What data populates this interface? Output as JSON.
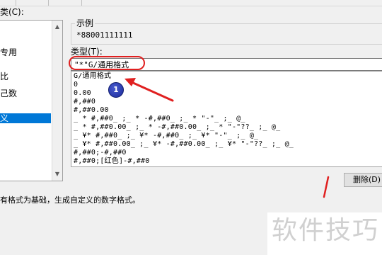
{
  "dialog": {
    "category_label": "类(C):",
    "category_items": [
      "专用",
      "比",
      "己数",
      "义"
    ],
    "sample_title": "示例",
    "sample_value": "*88001111111",
    "type_label": "类型(T):",
    "type_input_value": "\"*\"G/通用格式",
    "format_list": [
      "G/通用格式",
      "0",
      "0.00",
      "#,##0",
      "#,##0.00",
      "_ * #,##0_ ;_ * -#,##0_ ;_ * \"-\"_ ;_ @_",
      "_ * #,##0.00_ ;_ * -#,##0.00_ ;_ * \"-\"??_ ;_ @_",
      "_ ¥* #,##0_ ;_ ¥* -#,##0_ ;_ ¥* \"-\"_ ;_ @_",
      "_ ¥* #,##0.00_ ;_ ¥* -#,##0.00_ ;_ ¥* \"-\"??_ ;_ @_",
      "#,##0;-#,##0",
      "#,##0;[红色]-#,##0"
    ],
    "delete_button": "删除(D)",
    "description": "有格式为基础，生成自定义的数字格式。"
  },
  "annotations": {
    "badge_number": "1",
    "watermark": "软件技巧"
  },
  "colors": {
    "highlight_red": "#e02020",
    "selection_blue": "#0078d7",
    "badge_blue": "#1a2a9a"
  }
}
